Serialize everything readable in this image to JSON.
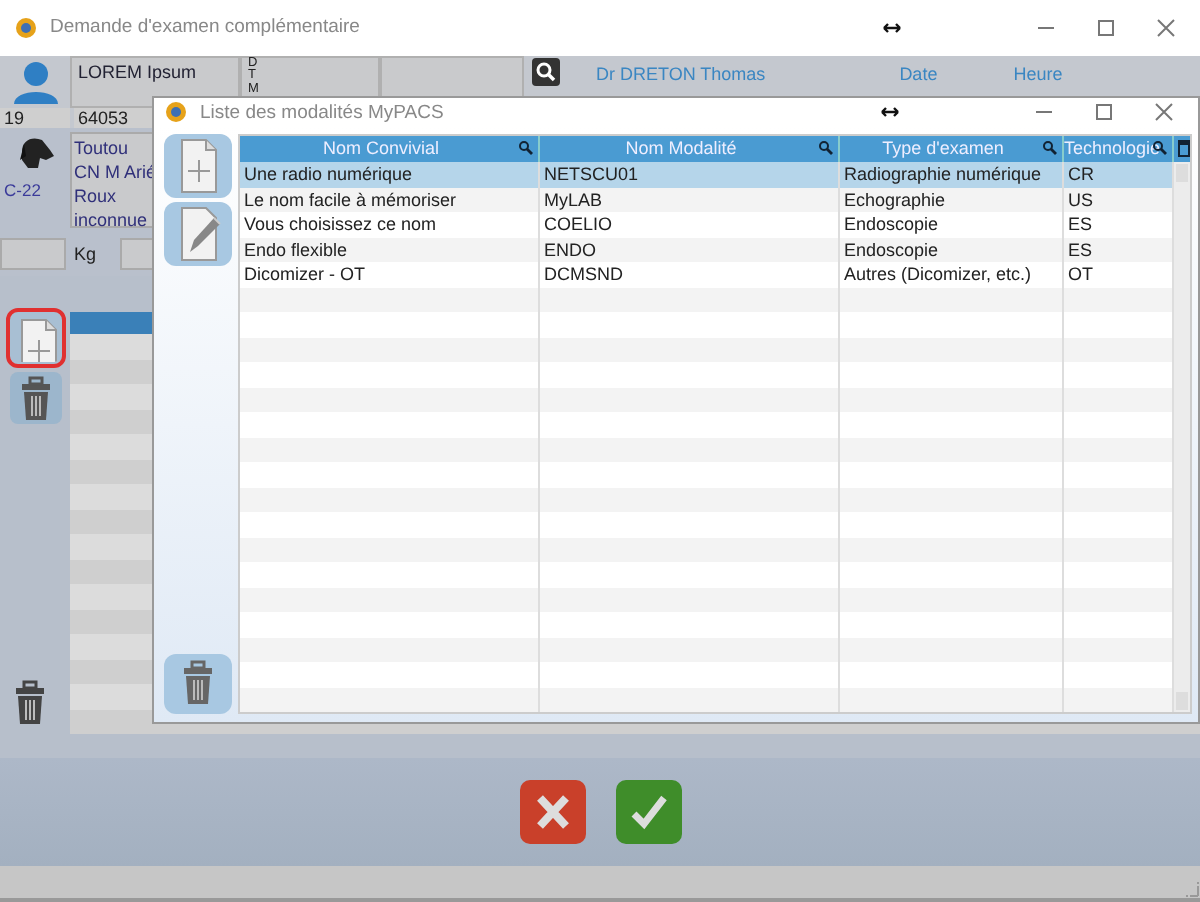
{
  "window": {
    "title": "Demande d'examen complémentaire"
  },
  "header": {
    "name": "LOREM Ipsum",
    "letters": [
      "D",
      "T",
      "M"
    ],
    "doctor": "Dr DRETON Thomas",
    "date_label": "Date",
    "time_label": "Heure"
  },
  "patient": {
    "short_id": "19",
    "number": "64053",
    "description": [
      "Toutou",
      "CN M Arié",
      "Roux",
      "inconnue"
    ],
    "code": "C-22",
    "weight_unit": "Kg"
  },
  "side_tools": [
    {
      "kind": "new",
      "focused": true
    },
    {
      "kind": "delete",
      "focused": false
    }
  ],
  "dialog": {
    "title": "Liste des modalités MyPACS",
    "columns": [
      "Nom Convivial",
      "Nom Modalité",
      "Type d'examen",
      "Technologie"
    ],
    "rows": [
      {
        "cells": [
          "Une radio numérique",
          "NETSCU01",
          "Radiographie numérique",
          "CR"
        ],
        "selected": true
      },
      {
        "cells": [
          "Le nom facile à mémoriser",
          "MyLAB",
          "Echographie",
          "US"
        ],
        "selected": false
      },
      {
        "cells": [
          "Vous choisissez ce nom",
          "COELIO",
          "Endoscopie",
          "ES"
        ],
        "selected": false
      },
      {
        "cells": [
          "Endo flexible",
          "ENDO",
          "Endoscopie",
          "ES"
        ],
        "selected": false
      },
      {
        "cells": [
          "Dicomizer - OT",
          "DCMSND",
          "Autres (Dicomizer, etc.)",
          "OT"
        ],
        "selected": false
      }
    ]
  },
  "actions": [
    {
      "kind": "cancel"
    },
    {
      "kind": "ok"
    }
  ]
}
